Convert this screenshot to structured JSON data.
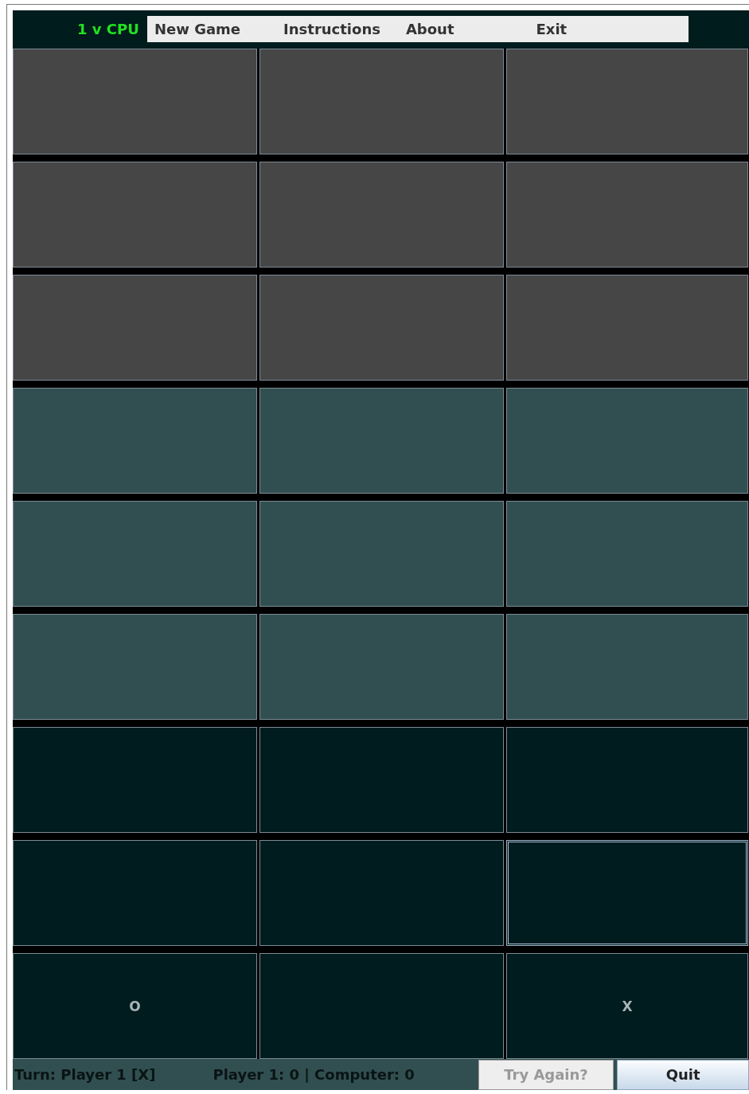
{
  "mode_label": "1 v CPU",
  "menu": [
    {
      "label": "New Game"
    },
    {
      "label": "Instructions"
    },
    {
      "label": "About"
    },
    {
      "label": "Exit"
    }
  ],
  "boards": [
    {
      "color": "#464646",
      "rows": [
        [
          {
            "focused": false
          },
          {
            "focused": false
          },
          {
            "focused": false
          }
        ],
        [
          {
            "focused": false
          },
          {
            "focused": false
          },
          {
            "focused": false
          }
        ],
        [
          {
            "focused": false
          },
          {
            "focused": false
          },
          {
            "focused": false
          }
        ]
      ]
    },
    {
      "color": "#314f50",
      "rows": [
        [
          {
            "focused": false
          },
          {
            "focused": false
          },
          {
            "focused": false
          }
        ],
        [
          {
            "focused": false
          },
          {
            "focused": false
          },
          {
            "focused": false
          }
        ],
        [
          {
            "focused": false
          },
          {
            "focused": false
          },
          {
            "focused": false
          }
        ]
      ]
    },
    {
      "color": "#001c1e",
      "rows": [
        [
          {
            "focused": false
          },
          {
            "focused": false
          },
          {
            "focused": false
          }
        ],
        [
          {
            "focused": false
          },
          {
            "focused": false
          },
          {
            "focused": true
          }
        ],
        [
          {
            "focused": false,
            "mark": "O"
          },
          {
            "focused": false
          },
          {
            "focused": false,
            "mark": "X"
          }
        ]
      ]
    }
  ],
  "status": {
    "turn": "Turn: Player 1 [X]",
    "score": "Player 1: 0 | Computer: 0"
  },
  "buttons": [
    {
      "label": "Try Again?",
      "disabled": true
    },
    {
      "label": "Quit",
      "disabled": false
    }
  ]
}
